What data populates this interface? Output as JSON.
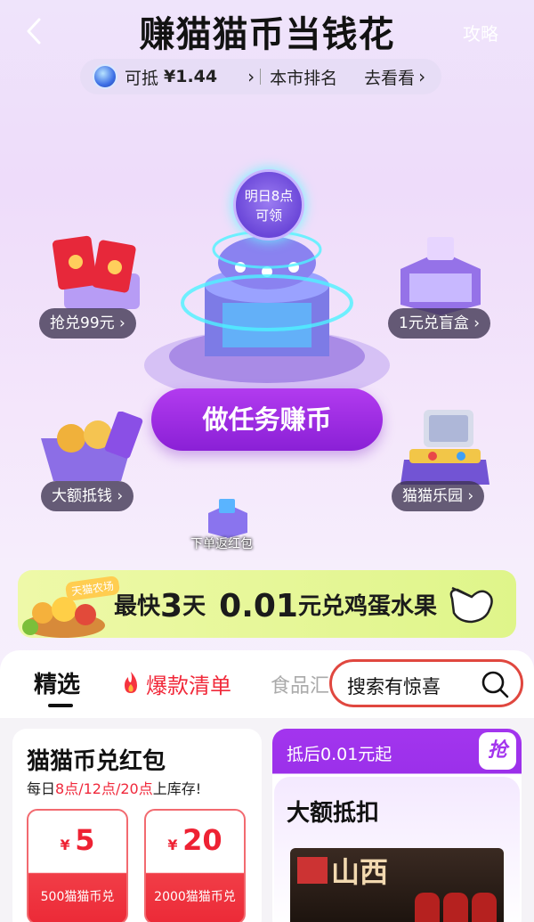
{
  "header": {
    "title": "赚猫猫币当钱花",
    "guide_label": "攻略"
  },
  "coin_bar": {
    "offset_label": "可抵",
    "amount": "¥1.44",
    "ranking_label": "本市排名",
    "go_label": "去看看"
  },
  "center": {
    "claim_line1": "明日8点",
    "claim_line2": "可领",
    "task_button": "做任务赚币"
  },
  "side_items": {
    "redeem_99": "抢兑99元",
    "blind_box": "1元兑盲盒",
    "big_discount": "大额抵钱",
    "paradise": "猫猫乐园",
    "order_rebate": "下单返红包"
  },
  "banner": {
    "farm_tag": "天猫农场",
    "text_pre": "最快",
    "days": "3",
    "text_mid": "天",
    "price": "0.01",
    "text_post": "元兑鸡蛋水果"
  },
  "tabs": {
    "selected": "精选",
    "hot": "爆款清单",
    "food": "食品汇",
    "search_placeholder": "搜索有惊喜"
  },
  "card_left": {
    "title": "猫猫币兑红包",
    "sub_pre": "每日",
    "sub_times": "8点/12点/20点",
    "sub_post": "上库存!",
    "coupons": [
      {
        "currency": "¥",
        "value": "5",
        "caption": "500猫猫币兑"
      },
      {
        "currency": "¥",
        "value": "20",
        "caption": "2000猫猫币兑"
      }
    ]
  },
  "card_right": {
    "header": "抵后0.01元起",
    "grab": "抢",
    "title": "大额抵扣",
    "product_brand": "山西"
  },
  "colors": {
    "accent_purple": "#a335ee",
    "accent_red": "#f0283b",
    "banner_green": "#e4f79a"
  }
}
